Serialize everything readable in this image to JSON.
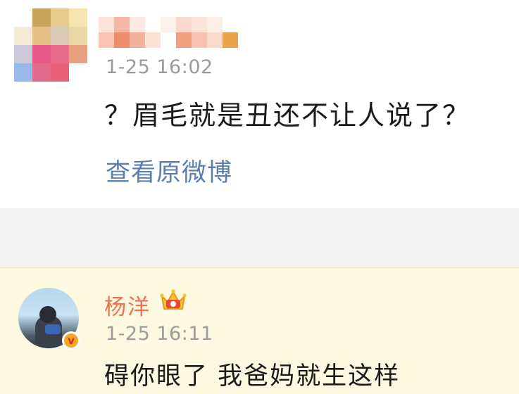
{
  "comment1": {
    "timestamp": "1-25 16:02",
    "text": "？眉毛就是丑还不让人说了？",
    "view_original_label": "查看原微博"
  },
  "comment2": {
    "username": "杨洋",
    "timestamp": "1-25 16:11",
    "text": "碍你眼了 我爸妈就生这样",
    "verified_badge_label": "v"
  },
  "colors": {
    "username": "#eb7350",
    "timestamp": "#9b9b9b",
    "link": "#5b7fad",
    "highlight_bg": "#fdf8e0",
    "separator_bg": "#f2f2f2"
  },
  "icons": [
    "avatar-pixelated",
    "name-pixelated",
    "crown-icon",
    "verified-badge-icon"
  ]
}
